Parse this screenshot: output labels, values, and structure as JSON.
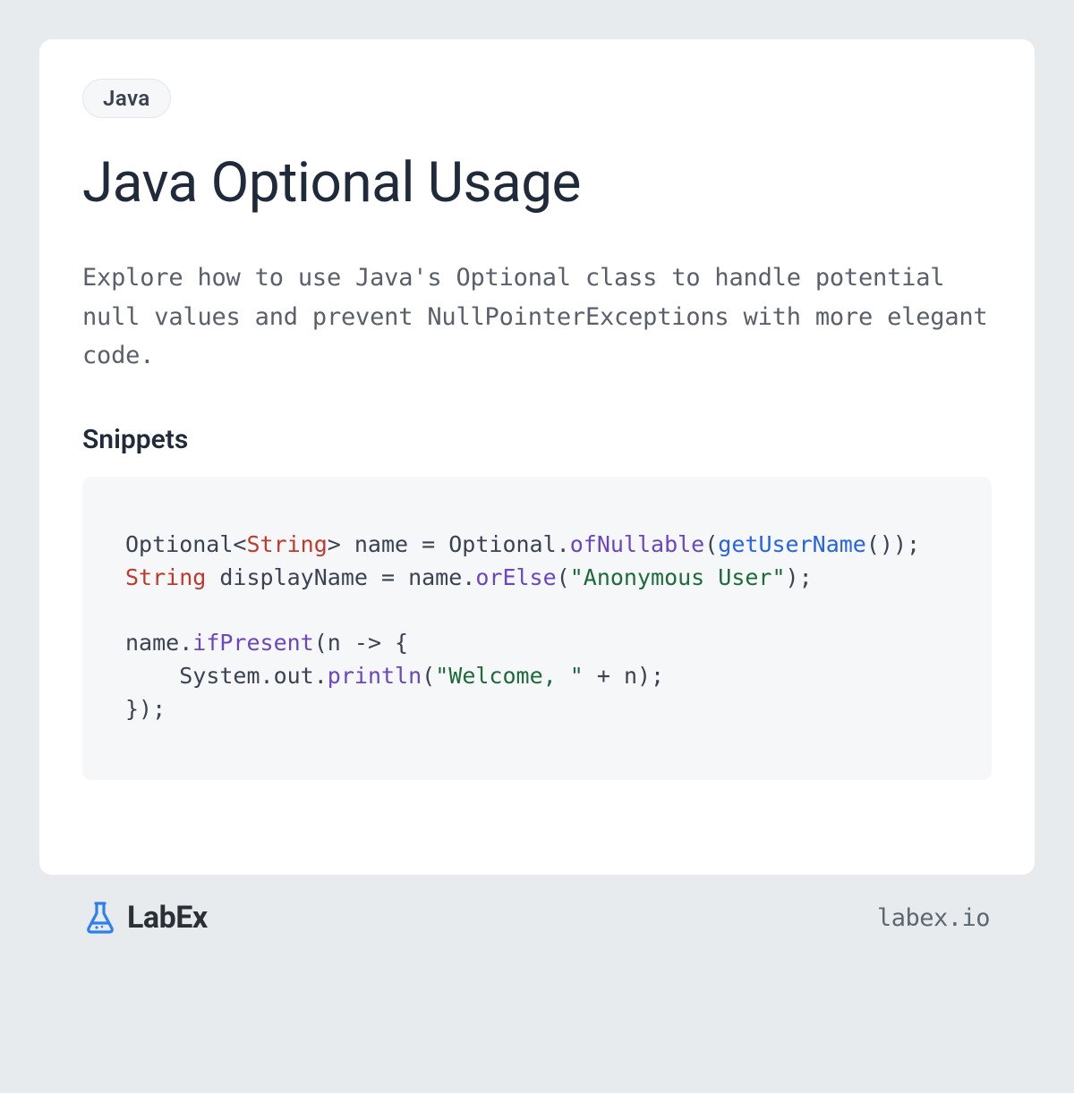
{
  "tag": "Java",
  "title": "Java Optional Usage",
  "description": "Explore how to use Java's Optional class to handle potential null values and prevent NullPointerExceptions with more elegant code.",
  "snippets_heading": "Snippets",
  "code": {
    "tokens": [
      {
        "t": "Optional<",
        "c": "plain"
      },
      {
        "t": "String",
        "c": "type"
      },
      {
        "t": "> name = Optional.",
        "c": "plain"
      },
      {
        "t": "ofNullable",
        "c": "method"
      },
      {
        "t": "(",
        "c": "plain"
      },
      {
        "t": "getUserName",
        "c": "call"
      },
      {
        "t": "());\n",
        "c": "plain"
      },
      {
        "t": "String",
        "c": "type"
      },
      {
        "t": " displayName = name.",
        "c": "plain"
      },
      {
        "t": "orElse",
        "c": "method"
      },
      {
        "t": "(",
        "c": "plain"
      },
      {
        "t": "\"Anonymous User\"",
        "c": "string"
      },
      {
        "t": ");\n\nname.",
        "c": "plain"
      },
      {
        "t": "ifPresent",
        "c": "method"
      },
      {
        "t": "(n -> {\n    System.out.",
        "c": "plain"
      },
      {
        "t": "println",
        "c": "method"
      },
      {
        "t": "(",
        "c": "plain"
      },
      {
        "t": "\"Welcome, \"",
        "c": "string"
      },
      {
        "t": " + n);\n});",
        "c": "plain"
      }
    ]
  },
  "brand": "LabEx",
  "url": "labex.io"
}
